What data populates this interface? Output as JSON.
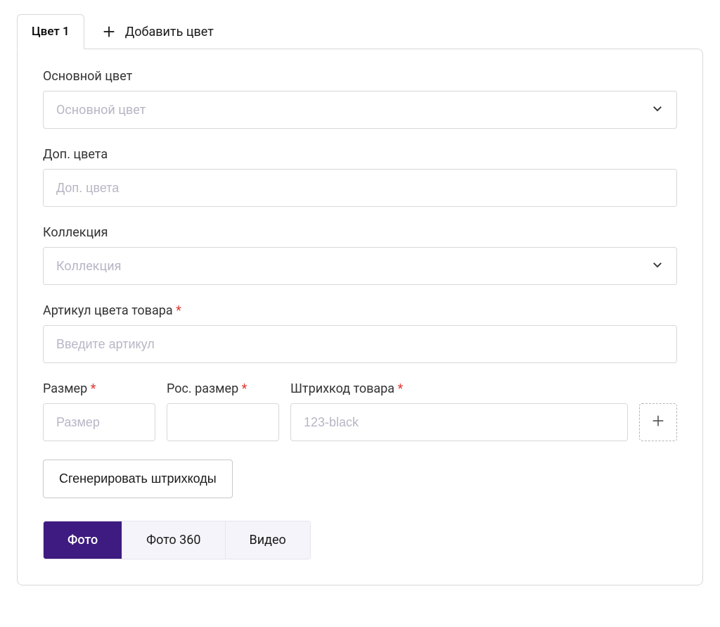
{
  "tabs": {
    "color_tab_label": "Цвет 1",
    "add_color_label": "Добавить цвет"
  },
  "fields": {
    "main_color": {
      "label": "Основной цвет",
      "placeholder": "Основной цвет"
    },
    "extra_colors": {
      "label": "Доп. цвета",
      "placeholder": "Доп. цвета"
    },
    "collection": {
      "label": "Коллекция",
      "placeholder": "Коллекция"
    },
    "article": {
      "label": "Артикул цвета товара",
      "placeholder": "Введите артикул"
    },
    "size": {
      "label": "Размер",
      "placeholder": "Размер"
    },
    "ru_size": {
      "label": "Рос. размер",
      "placeholder": ""
    },
    "barcode": {
      "label": "Штрихкод товара",
      "placeholder": "123-black"
    }
  },
  "buttons": {
    "generate_barcodes": "Сгенерировать штрихкоды"
  },
  "media_tabs": {
    "photo": "Фото",
    "photo360": "Фото 360",
    "video": "Видео"
  }
}
